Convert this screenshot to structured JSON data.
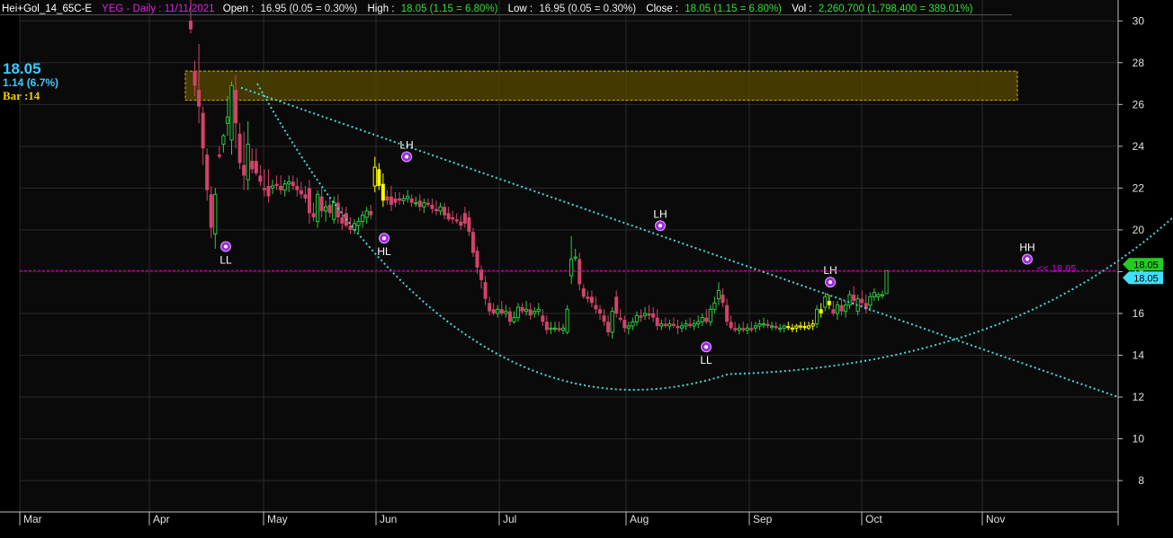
{
  "header": {
    "symbol": "Hei+Gol_14_65C-E",
    "title": "YEG - Daily : 11/11/2021",
    "open_label": "Open :",
    "open_value": "16.95 (0.05 = 0.30%)",
    "high_label": "High :",
    "high_value": "18.05 (1.15 = 6.80%)",
    "low_label": "Low :",
    "low_value": "16.95 (0.05 = 0.30%)",
    "close_label": "Close :",
    "close_value": "18.05 (1.15 = 6.80%)",
    "vol_label": "Vol :",
    "vol_value": "2,260,700 (1,798,400 = 389.01%)"
  },
  "info": {
    "last_price": "18.05",
    "change": "1.14 (6.7%)",
    "bar": "Bar :14"
  },
  "colors": {
    "background": "#000000",
    "bear_candle": "#d2436a",
    "bull_candle": "#2ecc40",
    "neutral_candle": "#ffff00",
    "trend_line": "#4ad6d6",
    "zone_fill": "#5a4a00",
    "zone_border": "#d4b000",
    "pivot_marker": "#9b2fd6",
    "price_line": "#d000d0",
    "header_blue": "#40c8ff",
    "header_yellow": "#f0d000"
  },
  "chart_data": {
    "type": "candlestick",
    "ylim": [
      6.5,
      31
    ],
    "y_ticks": [
      "8",
      "10",
      "12",
      "14",
      "16",
      "18",
      "20",
      "22",
      "24",
      "26",
      "28",
      "30"
    ],
    "x_ticks": [
      "Mar",
      "Apr",
      "May",
      "Jun",
      "Jul",
      "Aug",
      "Sep",
      "Oct",
      "Nov"
    ],
    "price_line": {
      "value": 18.05,
      "label": "<< 18.05"
    },
    "axis_tags": [
      "18.05",
      "18.05"
    ],
    "resistance_zone": {
      "low": 26.2,
      "high": 27.6
    },
    "pivots": [
      {
        "label": "LL",
        "price": 19.2,
        "kind": "low"
      },
      {
        "label": "HL",
        "price": 19.6,
        "kind": "low"
      },
      {
        "label": "LH",
        "price": 23.5,
        "kind": "high"
      },
      {
        "label": "LH",
        "price": 20.2,
        "kind": "high"
      },
      {
        "label": "LL",
        "price": 14.4,
        "kind": "low"
      },
      {
        "label": "LH",
        "price": 17.5,
        "kind": "high"
      },
      {
        "label": "HH",
        "price": 18.6,
        "kind": "high"
      }
    ],
    "trend_line": {
      "start": 26.8,
      "end": 12.0
    },
    "arc_curve": {
      "start": 27.0,
      "bottom": 13.1,
      "end": 20.6
    },
    "candles": [
      {
        "o": 30.0,
        "h": 31.0,
        "l": 29.4,
        "c": 29.6
      },
      {
        "o": 27.6,
        "h": 28.1,
        "l": 26.4,
        "c": 26.9
      },
      {
        "o": 26.7,
        "h": 28.9,
        "l": 25.1,
        "c": 25.9
      },
      {
        "o": 25.6,
        "h": 25.9,
        "l": 23.1,
        "c": 23.9
      },
      {
        "o": 23.6,
        "h": 23.9,
        "l": 21.4,
        "c": 21.9
      },
      {
        "o": 21.7,
        "h": 22.1,
        "l": 19.6,
        "c": 20.1
      },
      {
        "o": 19.8,
        "h": 22.0,
        "l": 19.1,
        "c": 21.7
      },
      {
        "o": 23.6,
        "h": 24.0,
        "l": 23.4,
        "c": 23.5
      },
      {
        "o": 24.1,
        "h": 24.6,
        "l": 23.7,
        "c": 24.5
      },
      {
        "o": 25.1,
        "h": 26.4,
        "l": 24.5,
        "c": 25.4
      },
      {
        "o": 24.3,
        "h": 27.1,
        "l": 23.6,
        "c": 26.9
      },
      {
        "o": 26.7,
        "h": 27.4,
        "l": 23.9,
        "c": 25.1
      },
      {
        "o": 24.6,
        "h": 25.1,
        "l": 22.9,
        "c": 23.2
      },
      {
        "o": 23.1,
        "h": 24.7,
        "l": 21.9,
        "c": 22.6
      },
      {
        "o": 22.4,
        "h": 25.2,
        "l": 21.9,
        "c": 24.1
      },
      {
        "o": 23.3,
        "h": 23.9,
        "l": 22.7,
        "c": 22.9
      },
      {
        "o": 23.3,
        "h": 23.9,
        "l": 22.6,
        "c": 22.7
      },
      {
        "o": 22.6,
        "h": 23.1,
        "l": 22.1,
        "c": 22.3
      },
      {
        "o": 22.0,
        "h": 22.9,
        "l": 21.6,
        "c": 21.9
      },
      {
        "o": 22.1,
        "h": 22.9,
        "l": 21.3,
        "c": 21.6
      },
      {
        "o": 22.0,
        "h": 22.4,
        "l": 21.7,
        "c": 22.1
      },
      {
        "o": 22.2,
        "h": 22.6,
        "l": 21.9,
        "c": 22.1
      },
      {
        "o": 22.1,
        "h": 22.6,
        "l": 21.7,
        "c": 21.9
      },
      {
        "o": 21.9,
        "h": 22.4,
        "l": 21.6,
        "c": 22.2
      },
      {
        "o": 22.2,
        "h": 22.6,
        "l": 21.8,
        "c": 22.3
      },
      {
        "o": 22.3,
        "h": 22.6,
        "l": 21.9,
        "c": 22.1
      },
      {
        "o": 22.1,
        "h": 22.5,
        "l": 21.6,
        "c": 21.9
      },
      {
        "o": 21.9,
        "h": 22.3,
        "l": 21.5,
        "c": 21.7
      },
      {
        "o": 21.7,
        "h": 22.1,
        "l": 21.3,
        "c": 21.5
      },
      {
        "o": 22.0,
        "h": 22.4,
        "l": 20.3,
        "c": 20.8
      },
      {
        "o": 20.8,
        "h": 21.3,
        "l": 20.4,
        "c": 20.6
      },
      {
        "o": 20.4,
        "h": 21.9,
        "l": 20.1,
        "c": 21.7
      },
      {
        "o": 21.6,
        "h": 22.0,
        "l": 20.6,
        "c": 20.9
      },
      {
        "o": 20.9,
        "h": 21.4,
        "l": 20.4,
        "c": 21.1
      },
      {
        "o": 21.2,
        "h": 21.6,
        "l": 20.6,
        "c": 20.8
      },
      {
        "o": 20.5,
        "h": 21.6,
        "l": 20.3,
        "c": 21.3
      },
      {
        "o": 21.3,
        "h": 21.7,
        "l": 20.3,
        "c": 20.6
      },
      {
        "o": 20.6,
        "h": 21.1,
        "l": 20.0,
        "c": 20.3
      },
      {
        "o": 20.8,
        "h": 21.1,
        "l": 20.1,
        "c": 20.2
      },
      {
        "o": 20.2,
        "h": 20.6,
        "l": 19.8,
        "c": 20.0
      },
      {
        "o": 20.0,
        "h": 20.5,
        "l": 19.8,
        "c": 20.3
      },
      {
        "o": 20.2,
        "h": 20.6,
        "l": 19.9,
        "c": 20.4
      },
      {
        "o": 20.4,
        "h": 20.9,
        "l": 20.1,
        "c": 20.7
      },
      {
        "o": 20.6,
        "h": 21.1,
        "l": 20.3,
        "c": 20.9
      },
      {
        "o": 20.9,
        "h": 21.2,
        "l": 20.5,
        "c": 20.7
      },
      {
        "o": 22.1,
        "h": 23.5,
        "l": 21.8,
        "c": 23.0
      },
      {
        "o": 22.9,
        "h": 23.2,
        "l": 21.9,
        "c": 22.1
      },
      {
        "o": 22.2,
        "h": 22.7,
        "l": 21.1,
        "c": 21.4
      },
      {
        "o": 21.6,
        "h": 21.9,
        "l": 21.2,
        "c": 21.4
      },
      {
        "o": 21.6,
        "h": 22.1,
        "l": 20.9,
        "c": 21.2
      },
      {
        "o": 21.5,
        "h": 21.8,
        "l": 21.1,
        "c": 21.3
      },
      {
        "o": 21.5,
        "h": 21.8,
        "l": 21.2,
        "c": 21.4
      },
      {
        "o": 21.4,
        "h": 21.7,
        "l": 21.2,
        "c": 21.5
      },
      {
        "o": 21.5,
        "h": 21.9,
        "l": 21.3,
        "c": 21.6
      },
      {
        "o": 21.5,
        "h": 21.7,
        "l": 21.1,
        "c": 21.3
      },
      {
        "o": 21.3,
        "h": 21.6,
        "l": 21.1,
        "c": 21.3
      },
      {
        "o": 21.4,
        "h": 21.7,
        "l": 20.9,
        "c": 21.1
      },
      {
        "o": 21.1,
        "h": 21.5,
        "l": 20.8,
        "c": 21.3
      },
      {
        "o": 21.3,
        "h": 21.5,
        "l": 21.1,
        "c": 21.2
      },
      {
        "o": 21.2,
        "h": 21.5,
        "l": 20.8,
        "c": 21.0
      },
      {
        "o": 21.0,
        "h": 21.4,
        "l": 20.7,
        "c": 20.9
      },
      {
        "o": 20.9,
        "h": 21.3,
        "l": 20.7,
        "c": 21.1
      },
      {
        "o": 21.1,
        "h": 21.3,
        "l": 20.5,
        "c": 20.7
      },
      {
        "o": 20.8,
        "h": 21.1,
        "l": 20.4,
        "c": 20.5
      },
      {
        "o": 20.6,
        "h": 20.9,
        "l": 20.3,
        "c": 20.5
      },
      {
        "o": 20.5,
        "h": 20.8,
        "l": 20.3,
        "c": 20.4
      },
      {
        "o": 20.4,
        "h": 20.7,
        "l": 20.0,
        "c": 20.2
      },
      {
        "o": 20.8,
        "h": 21.1,
        "l": 20.1,
        "c": 20.3
      },
      {
        "o": 20.6,
        "h": 20.9,
        "l": 19.7,
        "c": 19.9
      },
      {
        "o": 19.9,
        "h": 20.1,
        "l": 18.7,
        "c": 18.9
      },
      {
        "o": 19.0,
        "h": 19.2,
        "l": 17.9,
        "c": 18.2
      },
      {
        "o": 18.1,
        "h": 18.3,
        "l": 17.2,
        "c": 17.6
      },
      {
        "o": 17.5,
        "h": 17.8,
        "l": 16.4,
        "c": 16.7
      },
      {
        "o": 16.5,
        "h": 16.8,
        "l": 15.9,
        "c": 16.1
      },
      {
        "o": 16.2,
        "h": 16.5,
        "l": 15.9,
        "c": 16.0
      },
      {
        "o": 16.0,
        "h": 16.4,
        "l": 15.8,
        "c": 16.2
      },
      {
        "o": 16.2,
        "h": 16.6,
        "l": 15.9,
        "c": 16.0
      },
      {
        "o": 16.0,
        "h": 16.4,
        "l": 15.8,
        "c": 16.1
      },
      {
        "o": 16.1,
        "h": 16.3,
        "l": 15.4,
        "c": 15.6
      },
      {
        "o": 15.6,
        "h": 16.1,
        "l": 15.5,
        "c": 15.8
      },
      {
        "o": 15.8,
        "h": 16.5,
        "l": 15.6,
        "c": 16.3
      },
      {
        "o": 16.3,
        "h": 16.5,
        "l": 16.0,
        "c": 16.1
      },
      {
        "o": 16.1,
        "h": 16.6,
        "l": 15.9,
        "c": 16.2
      },
      {
        "o": 16.2,
        "h": 16.5,
        "l": 15.7,
        "c": 15.9
      },
      {
        "o": 16.0,
        "h": 16.3,
        "l": 15.8,
        "c": 16.1
      },
      {
        "o": 16.1,
        "h": 16.5,
        "l": 15.9,
        "c": 16.2
      },
      {
        "o": 15.9,
        "h": 16.2,
        "l": 15.4,
        "c": 15.6
      },
      {
        "o": 15.6,
        "h": 15.9,
        "l": 15.0,
        "c": 15.2
      },
      {
        "o": 15.3,
        "h": 15.6,
        "l": 15.0,
        "c": 15.3
      },
      {
        "o": 15.3,
        "h": 15.6,
        "l": 15.1,
        "c": 15.3
      },
      {
        "o": 15.3,
        "h": 15.6,
        "l": 15.1,
        "c": 15.2
      },
      {
        "o": 15.2,
        "h": 15.5,
        "l": 15.0,
        "c": 15.3
      },
      {
        "o": 15.1,
        "h": 16.4,
        "l": 15.0,
        "c": 16.2
      },
      {
        "o": 17.8,
        "h": 19.7,
        "l": 17.4,
        "c": 18.6
      },
      {
        "o": 18.7,
        "h": 19.1,
        "l": 18.5,
        "c": 18.7
      },
      {
        "o": 18.6,
        "h": 18.9,
        "l": 17.1,
        "c": 17.4
      },
      {
        "o": 17.2,
        "h": 17.4,
        "l": 16.7,
        "c": 16.8
      },
      {
        "o": 16.8,
        "h": 17.1,
        "l": 16.5,
        "c": 16.7
      },
      {
        "o": 16.8,
        "h": 17.1,
        "l": 16.3,
        "c": 16.5
      },
      {
        "o": 16.4,
        "h": 16.8,
        "l": 16.0,
        "c": 16.2
      },
      {
        "o": 16.2,
        "h": 16.4,
        "l": 15.7,
        "c": 16.0
      },
      {
        "o": 15.9,
        "h": 16.2,
        "l": 15.4,
        "c": 15.6
      },
      {
        "o": 15.6,
        "h": 15.9,
        "l": 14.9,
        "c": 15.1
      },
      {
        "o": 15.1,
        "h": 16.3,
        "l": 14.8,
        "c": 16.1
      },
      {
        "o": 16.8,
        "h": 17.1,
        "l": 15.8,
        "c": 16.0
      },
      {
        "o": 15.8,
        "h": 16.2,
        "l": 15.6,
        "c": 15.7
      },
      {
        "o": 15.7,
        "h": 15.9,
        "l": 15.1,
        "c": 15.3
      },
      {
        "o": 15.3,
        "h": 15.6,
        "l": 15.0,
        "c": 15.4
      },
      {
        "o": 15.4,
        "h": 15.8,
        "l": 15.2,
        "c": 15.6
      },
      {
        "o": 15.6,
        "h": 16.1,
        "l": 15.4,
        "c": 15.9
      },
      {
        "o": 15.9,
        "h": 16.2,
        "l": 15.6,
        "c": 15.8
      },
      {
        "o": 15.9,
        "h": 16.3,
        "l": 15.7,
        "c": 16.0
      },
      {
        "o": 16.0,
        "h": 16.4,
        "l": 15.7,
        "c": 15.9
      },
      {
        "o": 16.0,
        "h": 16.3,
        "l": 15.6,
        "c": 15.8
      },
      {
        "o": 15.8,
        "h": 16.2,
        "l": 15.2,
        "c": 15.4
      },
      {
        "o": 15.4,
        "h": 15.7,
        "l": 15.2,
        "c": 15.5
      },
      {
        "o": 15.5,
        "h": 15.8,
        "l": 15.3,
        "c": 15.4
      },
      {
        "o": 15.4,
        "h": 15.7,
        "l": 15.2,
        "c": 15.5
      },
      {
        "o": 15.5,
        "h": 15.8,
        "l": 15.3,
        "c": 15.4
      },
      {
        "o": 15.4,
        "h": 15.7,
        "l": 15.0,
        "c": 15.3
      },
      {
        "o": 15.3,
        "h": 15.6,
        "l": 15.1,
        "c": 15.4
      },
      {
        "o": 15.4,
        "h": 15.7,
        "l": 15.2,
        "c": 15.5
      },
      {
        "o": 15.5,
        "h": 15.8,
        "l": 15.3,
        "c": 15.4
      },
      {
        "o": 15.4,
        "h": 15.7,
        "l": 15.2,
        "c": 15.5
      },
      {
        "o": 15.5,
        "h": 15.9,
        "l": 15.3,
        "c": 15.6
      },
      {
        "o": 15.6,
        "h": 16.0,
        "l": 15.4,
        "c": 15.8
      },
      {
        "o": 15.8,
        "h": 16.2,
        "l": 15.5,
        "c": 15.6
      },
      {
        "o": 15.6,
        "h": 16.4,
        "l": 15.4,
        "c": 16.2
      },
      {
        "o": 16.2,
        "h": 16.8,
        "l": 16.0,
        "c": 16.5
      },
      {
        "o": 16.7,
        "h": 17.5,
        "l": 16.4,
        "c": 17.1
      },
      {
        "o": 16.9,
        "h": 17.2,
        "l": 16.3,
        "c": 16.5
      },
      {
        "o": 16.4,
        "h": 16.7,
        "l": 15.4,
        "c": 15.6
      },
      {
        "o": 15.6,
        "h": 15.9,
        "l": 15.2,
        "c": 15.3
      },
      {
        "o": 15.3,
        "h": 15.6,
        "l": 15.1,
        "c": 15.2
      },
      {
        "o": 15.2,
        "h": 15.5,
        "l": 15.0,
        "c": 15.3
      },
      {
        "o": 15.3,
        "h": 15.6,
        "l": 15.1,
        "c": 15.2
      },
      {
        "o": 15.2,
        "h": 15.5,
        "l": 15.0,
        "c": 15.3
      },
      {
        "o": 15.3,
        "h": 15.6,
        "l": 15.1,
        "c": 15.2
      },
      {
        "o": 15.3,
        "h": 15.6,
        "l": 15.1,
        "c": 15.4
      },
      {
        "o": 15.4,
        "h": 15.7,
        "l": 15.2,
        "c": 15.5
      },
      {
        "o": 15.5,
        "h": 15.8,
        "l": 15.3,
        "c": 15.5
      },
      {
        "o": 15.5,
        "h": 15.7,
        "l": 15.3,
        "c": 15.4
      },
      {
        "o": 15.4,
        "h": 15.6,
        "l": 15.2,
        "c": 15.4
      },
      {
        "o": 15.4,
        "h": 15.6,
        "l": 15.2,
        "c": 15.3
      },
      {
        "o": 15.3,
        "h": 15.5,
        "l": 15.1,
        "c": 15.3
      },
      {
        "o": 15.3,
        "h": 15.5,
        "l": 15.1,
        "c": 15.4
      },
      {
        "o": 15.4,
        "h": 15.6,
        "l": 15.2,
        "c": 15.3
      },
      {
        "o": 15.3,
        "h": 15.5,
        "l": 15.1,
        "c": 15.3
      },
      {
        "o": 15.3,
        "h": 15.5,
        "l": 15.1,
        "c": 15.4
      },
      {
        "o": 15.4,
        "h": 15.6,
        "l": 15.2,
        "c": 15.4
      },
      {
        "o": 15.4,
        "h": 15.6,
        "l": 15.2,
        "c": 15.3
      },
      {
        "o": 15.3,
        "h": 15.6,
        "l": 15.2,
        "c": 15.4
      },
      {
        "o": 15.4,
        "h": 15.7,
        "l": 15.2,
        "c": 15.5
      },
      {
        "o": 15.5,
        "h": 16.4,
        "l": 15.3,
        "c": 16.2
      },
      {
        "o": 16.2,
        "h": 16.5,
        "l": 15.8,
        "c": 16.0
      },
      {
        "o": 16.3,
        "h": 17.0,
        "l": 16.1,
        "c": 16.8
      },
      {
        "o": 16.6,
        "h": 16.9,
        "l": 16.2,
        "c": 16.4
      },
      {
        "o": 16.2,
        "h": 16.6,
        "l": 15.9,
        "c": 16.0
      },
      {
        "o": 16.0,
        "h": 16.6,
        "l": 15.7,
        "c": 16.4
      },
      {
        "o": 16.4,
        "h": 16.7,
        "l": 15.9,
        "c": 16.1
      },
      {
        "o": 16.1,
        "h": 16.6,
        "l": 15.8,
        "c": 16.4
      },
      {
        "o": 16.4,
        "h": 17.1,
        "l": 16.2,
        "c": 16.9
      },
      {
        "o": 16.9,
        "h": 17.3,
        "l": 16.4,
        "c": 16.6
      },
      {
        "o": 16.1,
        "h": 16.9,
        "l": 15.9,
        "c": 16.7
      },
      {
        "o": 16.7,
        "h": 17.1,
        "l": 16.3,
        "c": 16.5
      },
      {
        "o": 16.5,
        "h": 16.9,
        "l": 16.0,
        "c": 16.2
      },
      {
        "o": 16.4,
        "h": 17.0,
        "l": 16.1,
        "c": 16.8
      },
      {
        "o": 16.8,
        "h": 17.2,
        "l": 16.6,
        "c": 17.0
      },
      {
        "o": 16.8,
        "h": 17.0,
        "l": 16.6,
        "c": 16.9
      },
      {
        "o": 16.9,
        "h": 17.1,
        "l": 16.7,
        "c": 16.9
      },
      {
        "o": 16.95,
        "h": 18.05,
        "l": 16.95,
        "c": 18.05
      }
    ]
  }
}
